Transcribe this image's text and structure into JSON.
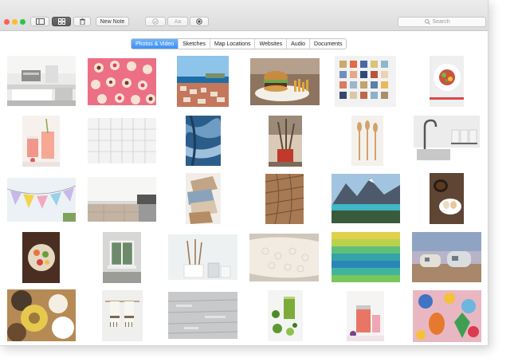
{
  "toolbar": {
    "new_note_label": "New Note",
    "format_label": "Aa",
    "search_placeholder": "Search"
  },
  "tabs": [
    {
      "label": "Photos & Video",
      "active": true
    },
    {
      "label": "Sketches",
      "active": false
    },
    {
      "label": "Map Locations",
      "active": false
    },
    {
      "label": "Websites",
      "active": false
    },
    {
      "label": "Audio",
      "active": false
    },
    {
      "label": "Documents",
      "active": false
    }
  ],
  "colors": {
    "accent": "#3d8ff7",
    "close": "#ff5f57",
    "minimize": "#febc2e",
    "zoom": "#28c840"
  },
  "attachments": [
    "kitchen-photo",
    "cupcakes-photo",
    "harbor-photo",
    "burger-photo",
    "color-swatches-photo",
    "salad-bowl-photo",
    "pink-drinks-photo",
    "white-tiles-photo",
    "blue-fabric-photo",
    "utensils-jar-photo",
    "wooden-spoons-photo",
    "faucet-sink-photo",
    "paper-bunting-photo",
    "counter-stove-photo",
    "fabric-samples-photo",
    "wood-planks-photo",
    "mountain-lake-photo",
    "coffee-eggs-photo",
    "food-platter-photo",
    "window-photo",
    "kitchen-tools-photo",
    "lace-fabric-photo",
    "colored-yarn-photo",
    "campers-photo",
    "yarn-spools-photo",
    "hanging-towels-photo",
    "rustic-wood-photo",
    "green-smoothie-photo",
    "jars-photo",
    "fruit-fabric-photo"
  ]
}
